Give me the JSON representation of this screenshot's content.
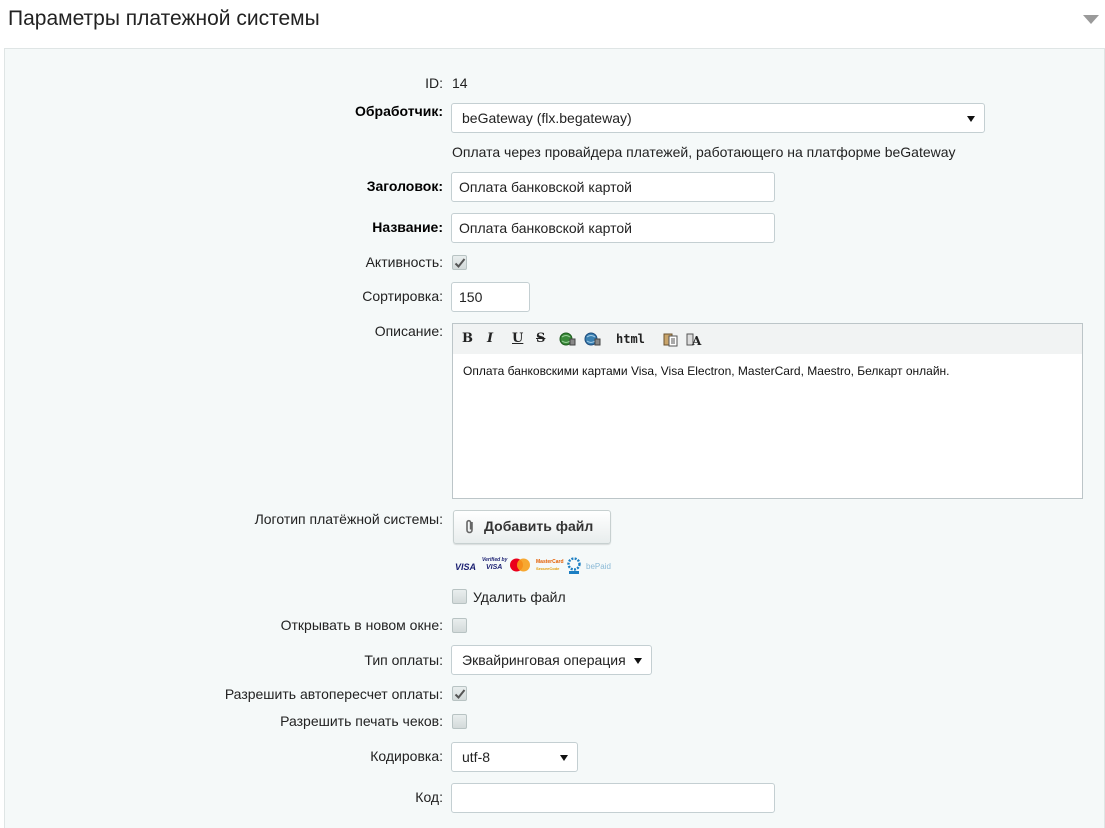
{
  "header": {
    "title": "Параметры платежной системы",
    "collapse_icon": "chevron-down-icon"
  },
  "form": {
    "id": {
      "label": "ID:",
      "value": "14"
    },
    "handler": {
      "label": "Обработчик:",
      "value": "beGateway (flx.begateway)",
      "description": "Оплата через провайдера платежей, работающего на платформе beGateway"
    },
    "header_field": {
      "label": "Заголовок:",
      "value": "Оплата банковской картой"
    },
    "name": {
      "label": "Название:",
      "value": "Оплата банковской картой"
    },
    "active": {
      "label": "Активность:",
      "checked": true
    },
    "sort": {
      "label": "Сортировка:",
      "value": "150"
    },
    "description": {
      "label": "Описание:",
      "toolbar": {
        "bold": "B",
        "italic": "I",
        "underline": "U",
        "strike": "S",
        "html": "html"
      },
      "text": "Оплата банковскими картами Visa, Visa Electron, MasterCard, Maestro, Белкарт онлайн."
    },
    "logo": {
      "label": "Логотип платёжной системы:",
      "add_button": "Добавить файл",
      "image_text": {
        "visa": "VISA",
        "verified_by": "Verified by",
        "verified_visa": "VISA",
        "mastercard": "MasterCard",
        "mastercard_sub": "SecureCode",
        "bepaid": "bePaid"
      },
      "delete_label": "Удалить файл"
    },
    "new_window": {
      "label": "Открывать в новом окне:",
      "checked": false
    },
    "payment_type": {
      "label": "Тип оплаты:",
      "value": "Эквайринговая операция"
    },
    "allow_recalc": {
      "label": "Разрешить автопересчет оплаты:",
      "checked": true
    },
    "allow_print": {
      "label": "Разрешить печать чеков:",
      "checked": false
    },
    "encoding": {
      "label": "Кодировка:",
      "value": "utf-8"
    },
    "code": {
      "label": "Код:",
      "value": ""
    }
  },
  "colors": {
    "panel_bg": "#f5f9f9",
    "border": "#c4cfd2",
    "mastercard_red": "#eb001b",
    "mastercard_orange": "#f79e1b",
    "visa_blue": "#1a1f71"
  }
}
